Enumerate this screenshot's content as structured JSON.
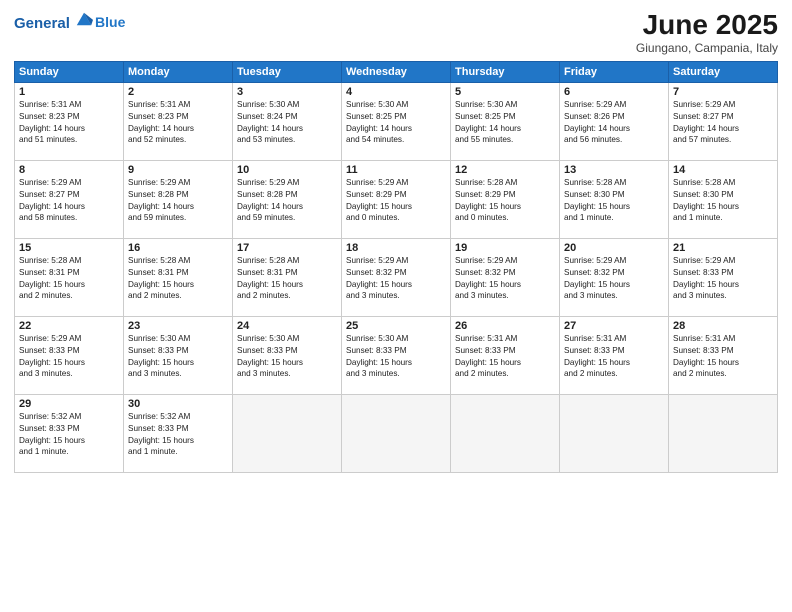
{
  "logo": {
    "line1": "General",
    "line2": "Blue"
  },
  "title": "June 2025",
  "subtitle": "Giungano, Campania, Italy",
  "header_days": [
    "Sunday",
    "Monday",
    "Tuesday",
    "Wednesday",
    "Thursday",
    "Friday",
    "Saturday"
  ],
  "weeks": [
    [
      {
        "day": "1",
        "info": "Sunrise: 5:31 AM\nSunset: 8:23 PM\nDaylight: 14 hours\nand 51 minutes."
      },
      {
        "day": "2",
        "info": "Sunrise: 5:31 AM\nSunset: 8:23 PM\nDaylight: 14 hours\nand 52 minutes."
      },
      {
        "day": "3",
        "info": "Sunrise: 5:30 AM\nSunset: 8:24 PM\nDaylight: 14 hours\nand 53 minutes."
      },
      {
        "day": "4",
        "info": "Sunrise: 5:30 AM\nSunset: 8:25 PM\nDaylight: 14 hours\nand 54 minutes."
      },
      {
        "day": "5",
        "info": "Sunrise: 5:30 AM\nSunset: 8:25 PM\nDaylight: 14 hours\nand 55 minutes."
      },
      {
        "day": "6",
        "info": "Sunrise: 5:29 AM\nSunset: 8:26 PM\nDaylight: 14 hours\nand 56 minutes."
      },
      {
        "day": "7",
        "info": "Sunrise: 5:29 AM\nSunset: 8:27 PM\nDaylight: 14 hours\nand 57 minutes."
      }
    ],
    [
      {
        "day": "8",
        "info": "Sunrise: 5:29 AM\nSunset: 8:27 PM\nDaylight: 14 hours\nand 58 minutes."
      },
      {
        "day": "9",
        "info": "Sunrise: 5:29 AM\nSunset: 8:28 PM\nDaylight: 14 hours\nand 59 minutes."
      },
      {
        "day": "10",
        "info": "Sunrise: 5:29 AM\nSunset: 8:28 PM\nDaylight: 14 hours\nand 59 minutes."
      },
      {
        "day": "11",
        "info": "Sunrise: 5:29 AM\nSunset: 8:29 PM\nDaylight: 15 hours\nand 0 minutes."
      },
      {
        "day": "12",
        "info": "Sunrise: 5:28 AM\nSunset: 8:29 PM\nDaylight: 15 hours\nand 0 minutes."
      },
      {
        "day": "13",
        "info": "Sunrise: 5:28 AM\nSunset: 8:30 PM\nDaylight: 15 hours\nand 1 minute."
      },
      {
        "day": "14",
        "info": "Sunrise: 5:28 AM\nSunset: 8:30 PM\nDaylight: 15 hours\nand 1 minute."
      }
    ],
    [
      {
        "day": "15",
        "info": "Sunrise: 5:28 AM\nSunset: 8:31 PM\nDaylight: 15 hours\nand 2 minutes."
      },
      {
        "day": "16",
        "info": "Sunrise: 5:28 AM\nSunset: 8:31 PM\nDaylight: 15 hours\nand 2 minutes."
      },
      {
        "day": "17",
        "info": "Sunrise: 5:28 AM\nSunset: 8:31 PM\nDaylight: 15 hours\nand 2 minutes."
      },
      {
        "day": "18",
        "info": "Sunrise: 5:29 AM\nSunset: 8:32 PM\nDaylight: 15 hours\nand 3 minutes."
      },
      {
        "day": "19",
        "info": "Sunrise: 5:29 AM\nSunset: 8:32 PM\nDaylight: 15 hours\nand 3 minutes."
      },
      {
        "day": "20",
        "info": "Sunrise: 5:29 AM\nSunset: 8:32 PM\nDaylight: 15 hours\nand 3 minutes."
      },
      {
        "day": "21",
        "info": "Sunrise: 5:29 AM\nSunset: 8:33 PM\nDaylight: 15 hours\nand 3 minutes."
      }
    ],
    [
      {
        "day": "22",
        "info": "Sunrise: 5:29 AM\nSunset: 8:33 PM\nDaylight: 15 hours\nand 3 minutes."
      },
      {
        "day": "23",
        "info": "Sunrise: 5:30 AM\nSunset: 8:33 PM\nDaylight: 15 hours\nand 3 minutes."
      },
      {
        "day": "24",
        "info": "Sunrise: 5:30 AM\nSunset: 8:33 PM\nDaylight: 15 hours\nand 3 minutes."
      },
      {
        "day": "25",
        "info": "Sunrise: 5:30 AM\nSunset: 8:33 PM\nDaylight: 15 hours\nand 3 minutes."
      },
      {
        "day": "26",
        "info": "Sunrise: 5:31 AM\nSunset: 8:33 PM\nDaylight: 15 hours\nand 2 minutes."
      },
      {
        "day": "27",
        "info": "Sunrise: 5:31 AM\nSunset: 8:33 PM\nDaylight: 15 hours\nand 2 minutes."
      },
      {
        "day": "28",
        "info": "Sunrise: 5:31 AM\nSunset: 8:33 PM\nDaylight: 15 hours\nand 2 minutes."
      }
    ],
    [
      {
        "day": "29",
        "info": "Sunrise: 5:32 AM\nSunset: 8:33 PM\nDaylight: 15 hours\nand 1 minute."
      },
      {
        "day": "30",
        "info": "Sunrise: 5:32 AM\nSunset: 8:33 PM\nDaylight: 15 hours\nand 1 minute."
      },
      {
        "day": "",
        "info": ""
      },
      {
        "day": "",
        "info": ""
      },
      {
        "day": "",
        "info": ""
      },
      {
        "day": "",
        "info": ""
      },
      {
        "day": "",
        "info": ""
      }
    ]
  ]
}
